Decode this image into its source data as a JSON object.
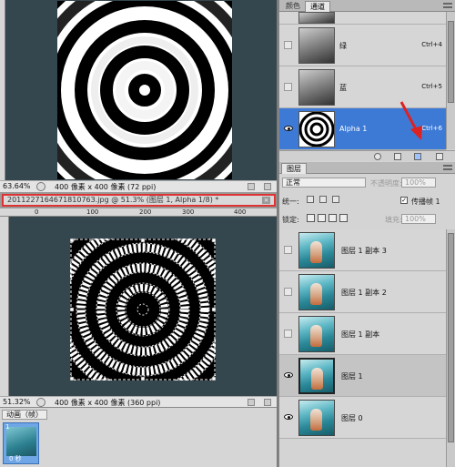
{
  "top_canvas": {
    "zoom": "63.64%",
    "doc_info": "400 像素 x 400 像素 (72 ppi)"
  },
  "document": {
    "title": "201122716467181076З.jpg @ 51.3% (图层 1, Alpha 1/8) *",
    "close_symbol": "×",
    "zoom": "51.32%",
    "doc_info": "400 像素 x 400 像素 (360 ppi)",
    "ruler_ticks": [
      "0",
      "100",
      "200",
      "300",
      "400"
    ]
  },
  "animation_panel": {
    "tab_label": "动画（帧）",
    "frame_number": "1",
    "frame_duration": "0 秒"
  },
  "channels_panel": {
    "tabs": [
      "颜色",
      "通道"
    ],
    "active_tab": "通道",
    "channels": [
      {
        "name": "绿",
        "shortcut": "Ctrl+4",
        "visible": false,
        "selected": false
      },
      {
        "name": "蓝",
        "shortcut": "Ctrl+5",
        "visible": false,
        "selected": false
      },
      {
        "name": "Alpha 1",
        "shortcut": "Ctrl+6",
        "visible": true,
        "selected": true
      }
    ]
  },
  "layers_panel": {
    "tab_label": "图层",
    "blend_mode": "正常",
    "opacity_label": "不透明度:",
    "opacity_value": "100%",
    "unify_label": "统一:",
    "propagate_label": "传播帧 1",
    "propagate_checked": true,
    "lock_label": "锁定:",
    "fill_label": "填充:",
    "fill_value": "100%",
    "layers": [
      {
        "name": "图层 1 副本 3",
        "visible": false,
        "selected": false
      },
      {
        "name": "图层 1 副本 2",
        "visible": false,
        "selected": false
      },
      {
        "name": "图层 1 副本",
        "visible": false,
        "selected": false
      },
      {
        "name": "图层 1",
        "visible": true,
        "selected": true
      },
      {
        "name": "图层 0",
        "visible": true,
        "selected": false
      }
    ]
  },
  "colors": {
    "canvas_background": "#34464e",
    "selection_blue": "#3d7ad6",
    "annotation_red": "#dd2222"
  }
}
